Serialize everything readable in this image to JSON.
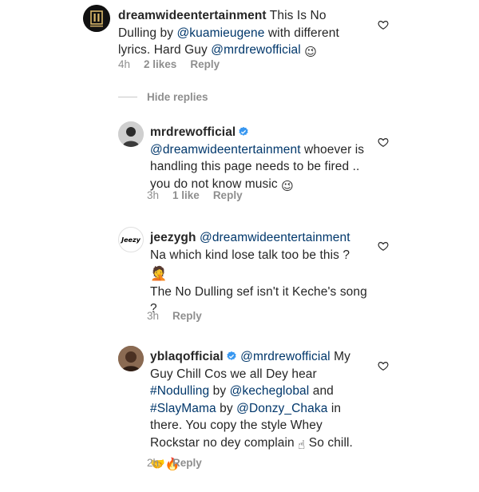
{
  "comments": [
    {
      "username": "dreamwideentertainment",
      "text_a": " This Is No Dulling by ",
      "mention_a": "@kuamieugene",
      "text_b": " with different lyrics. Hard Guy ",
      "mention_b": "@mrdrewofficial",
      "emoji": "😉",
      "time": "4h",
      "likes": "2 likes",
      "reply": "Reply"
    },
    {
      "username": "mrdrewofficial",
      "mention": "@dreamwideentertainment",
      "text": " whoever is handling this page needs to be fired .. you do not know music ",
      "emoji": "😉",
      "time": "3h",
      "likes": "1 like",
      "reply": "Reply"
    },
    {
      "username": "jeezygh",
      "mention": "@dreamwideentertainment",
      "text_a": " Na which kind lose talk too be this ?",
      "emoji": "🤦",
      "text_b": "The No Dulling sef isn't it Keche's song ?",
      "time": "3h",
      "reply": "Reply"
    },
    {
      "username": "yblaqofficial",
      "mention_a": "@mrdrewofficial",
      "text_a": " My Guy Chill Cos we all Dey hear ",
      "mention_b": "#Nodulling",
      "text_b": " by ",
      "mention_c": "@kecheglobal",
      "text_c": " and ",
      "mention_d": "#SlayMama",
      "text_d": " by ",
      "mention_e": "@Donzy_Chaka",
      "text_e": " in there. You copy the style  Whey Rockstar no dey  complain ",
      "emoji_a": "☝",
      "text_f": " So chill.",
      "emoji_b": "🤝🔥",
      "time": "2h",
      "reply": "Reply"
    }
  ],
  "hide_replies": "Hide replies",
  "avatar_label_jeezy": "Jeezy",
  "colors": {
    "link": "#00376b",
    "meta": "#8e8e8e",
    "verified": "#3897f0"
  }
}
